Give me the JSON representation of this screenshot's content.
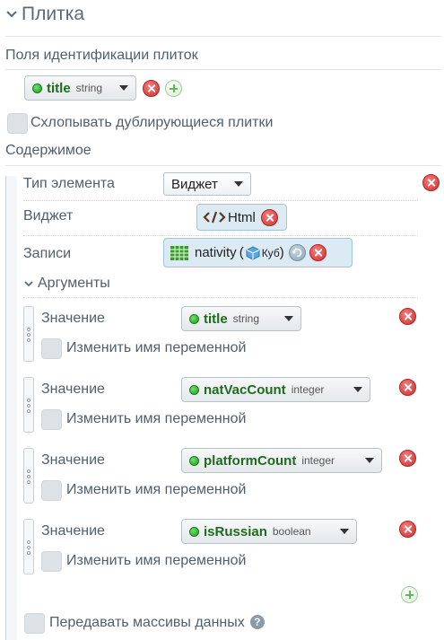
{
  "section": {
    "title": "Плитка"
  },
  "id_fields": {
    "label": "Поля идентификации плиток",
    "field": {
      "name": "title",
      "type": "string"
    }
  },
  "collapse_duplicates_label": "Схлопывать дублирующиеся плитки",
  "content": {
    "label": "Содержимое",
    "element_type": {
      "label": "Тип элемента",
      "value": "Виджет"
    },
    "widget": {
      "label": "Виджет",
      "value": "Html",
      "icon": "code-icon"
    },
    "records": {
      "label": "Записи",
      "dataset": "nativity",
      "source": "Куб",
      "icon": "table-grid-icon"
    },
    "arguments": {
      "label": "Аргументы",
      "items": [
        {
          "label": "Значение",
          "field": "title",
          "type": "string",
          "rename_label": "Изменить имя переменной"
        },
        {
          "label": "Значение",
          "field": "natVacCount",
          "type": "integer",
          "rename_label": "Изменить имя переменной"
        },
        {
          "label": "Значение",
          "field": "platformCount",
          "type": "integer",
          "rename_label": "Изменить имя переменной"
        },
        {
          "label": "Значение",
          "field": "isRussian",
          "type": "boolean",
          "rename_label": "Изменить имя переменной"
        }
      ]
    },
    "pass_arrays_label": "Передавать массивы данных",
    "help_glyph": "?"
  },
  "colors": {
    "field_green": "#1f6a1f",
    "remove_red": "#d22f2f",
    "add_green": "#5cbb53",
    "chip_blue": "#dbeaf3"
  }
}
